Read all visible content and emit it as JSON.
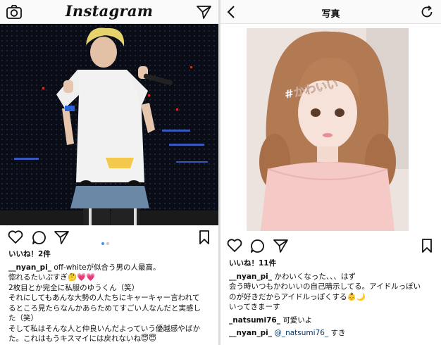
{
  "left": {
    "header": {
      "logo_text": "Instagram",
      "camera_icon": "camera-icon",
      "send_icon": "direct-send-icon"
    },
    "post": {
      "likes": "いいね！2件",
      "caption_user": "__nyan_pi_",
      "caption_lines": [
        "off-whiteが似合う男の人最高。",
        "惚れるたいぷすぎ🤔💗💗",
        "2枚目とか完全に私服のゆうくん（笑）",
        "それにしてもあんな大勢の人たちにキャーキャー言われて",
        "るところ見たらなんかあらためてすごい人なんだと実感し",
        "た（笑）",
        "そして私はそんな人と仲良いんだよっていう優越感やばか",
        "た。これはもうキスマイには戻れないね😇😇"
      ],
      "carousel_count": 2,
      "carousel_active": 1
    }
  },
  "right": {
    "header": {
      "back_icon": "chevron-left-icon",
      "title": "写真",
      "refresh_icon": "refresh-icon"
    },
    "photo_overlay_text": "#かわいい",
    "post": {
      "likes": "いいね！11件",
      "caption_user": "__nyan_pi_",
      "caption_lines": [
        "かわいくなった、、、はず",
        "会う時いつもかわいいの自己暗示してる。アイドルっぽい",
        "のが好きだからアイドルっぽくする👶🌙",
        "いってきまーす"
      ],
      "comments": [
        {
          "user": "_natsumi76_",
          "text": "可愛いよ"
        },
        {
          "user": "__nyan_pi_",
          "mention": "@_natsumi76_",
          "text": "すき"
        }
      ]
    }
  }
}
